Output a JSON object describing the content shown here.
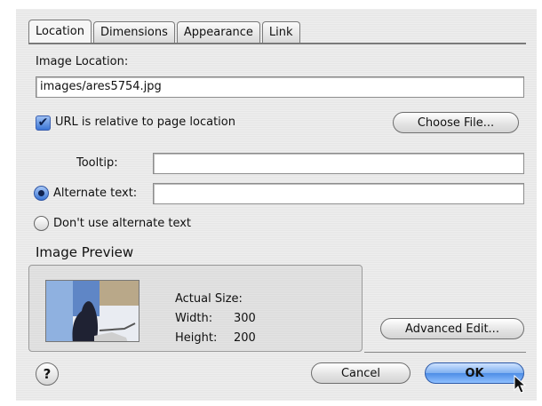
{
  "tabs": [
    {
      "label": "Location",
      "active": true
    },
    {
      "label": "Dimensions",
      "active": false
    },
    {
      "label": "Appearance",
      "active": false
    },
    {
      "label": "Link",
      "active": false
    }
  ],
  "location": {
    "image_location_label": "Image Location:",
    "image_location_value": "images/ares5754.jpg",
    "relative_checkbox_label": "URL is relative to page location",
    "relative_checked": true,
    "choose_file_button": "Choose File...",
    "tooltip_label": "Tooltip:",
    "tooltip_value": "",
    "alt_text_radio_label": "Alternate text:",
    "alt_text_selected": true,
    "alt_text_value": "",
    "no_alt_radio_label": "Don't use alternate text"
  },
  "preview": {
    "title": "Image Preview",
    "actual_size_label": "Actual Size:",
    "width_label": "Width:",
    "width_value": "300",
    "height_label": "Height:",
    "height_value": "200"
  },
  "buttons": {
    "advanced_edit": "Advanced Edit...",
    "help": "?",
    "cancel": "Cancel",
    "ok": "OK"
  },
  "colors": {
    "dialog_bg": "#ececec",
    "ok_button": "#4d8de6",
    "checkbox_accent": "#3b76d6"
  },
  "icons": {
    "checkbox": "checkmark-icon",
    "cursor": "arrow-cursor-icon"
  }
}
